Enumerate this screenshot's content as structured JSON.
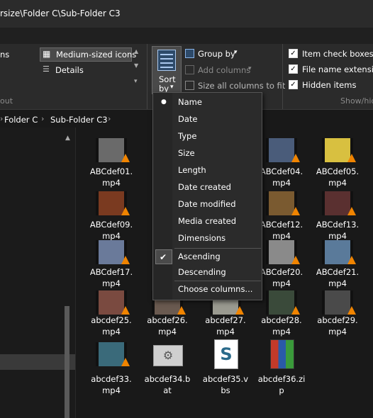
{
  "title": {
    "path": "rsize\\Folder C\\Sub-Folder C3"
  },
  "ribbon": {
    "layout": {
      "partial_left": "ns",
      "medium_icons": "Medium-sized icons",
      "details": "Details",
      "section_label": "out"
    },
    "sort": {
      "label_line1": "Sort",
      "label_line2": "by"
    },
    "group_by": "Group by",
    "add_columns": "Add columns",
    "size_all_columns": "Size all columns to fit",
    "options": {
      "item_check_boxes": "Item check boxes",
      "file_name_extensions": "File name extension",
      "hidden_items": "Hidden items",
      "section_label": "Show/hic"
    }
  },
  "address": {
    "crumbs": [
      "Folder C",
      "Sub-Folder C3"
    ]
  },
  "files": [
    {
      "name": "ABCdef01.mp4",
      "line1": "ABCdef01.",
      "line2": "mp4",
      "type": "video",
      "thumb": "#6a6a6a"
    },
    {
      "name": "ABCdef04.mp4",
      "line1": "ABCdef04.",
      "line2": "mp4",
      "type": "video",
      "thumb": "#4a5c7a"
    },
    {
      "name": "ABCdef05.mp4",
      "line1": "ABCdef05.",
      "line2": "mp4",
      "type": "video",
      "thumb": "#d8c040"
    },
    {
      "name": "ABCdef09.mp4",
      "line1": "ABCdef09.",
      "line2": "mp4",
      "type": "video",
      "thumb": "#7a3a20"
    },
    {
      "name": "ABCdef12.mp4",
      "line1": "ABCdef12.",
      "line2": "mp4",
      "type": "video",
      "thumb": "#7a5a30"
    },
    {
      "name": "ABCdef13.mp4",
      "line1": "ABCdef13.",
      "line2": "mp4",
      "type": "video",
      "thumb": "#5a3030"
    },
    {
      "name": "ABCdef17.mp4",
      "line1": "ABCdef17.",
      "line2": "mp4",
      "type": "video",
      "thumb": "#6a7a9a"
    },
    {
      "name": "ABCdef20.mp4",
      "line1": "ABCdef20.",
      "line2": "mp4",
      "type": "video",
      "thumb": "#8a8a8a"
    },
    {
      "name": "ABCdef21.mp4",
      "line1": "ABCdef21.",
      "line2": "mp4",
      "type": "video",
      "thumb": "#5a7a9a"
    },
    {
      "name": "abcdef25.mp4",
      "line1": "abcdef25.",
      "line2": "mp4",
      "type": "video",
      "thumb": "#7a4a40"
    },
    {
      "name": "abcdef26.mp4",
      "line1": "abcdef26.",
      "line2": "mp4",
      "type": "video",
      "thumb": "#6a5a50"
    },
    {
      "name": "abcdef27.mp4",
      "line1": "abcdef27.",
      "line2": "mp4",
      "type": "video",
      "thumb": "#9a9a90"
    },
    {
      "name": "abcdef28.mp4",
      "line1": "abcdef28.",
      "line2": "mp4",
      "type": "video",
      "thumb": "#3a4a3a"
    },
    {
      "name": "abcdef29.mp4",
      "line1": "abcdef29.",
      "line2": "mp4",
      "type": "video",
      "thumb": "#4a4a4a"
    },
    {
      "name": "abcdef33.mp4",
      "line1": "abcdef33.",
      "line2": "mp4",
      "type": "video",
      "thumb": "#3a6a7a"
    },
    {
      "name": "abcdef34.bat",
      "line1": "abcdef34.b",
      "line2": "at",
      "type": "bat",
      "thumb": "#cfcfcf"
    },
    {
      "name": "abcdef35.vbs",
      "line1": "abcdef35.v",
      "line2": "bs",
      "type": "vbs",
      "thumb": "#ffffff"
    },
    {
      "name": "abcdef36.zip",
      "line1": "abcdef36.zi",
      "line2": "p",
      "type": "zip",
      "thumb": "#c23a2a"
    }
  ],
  "sort_menu": {
    "items": [
      "Name",
      "Date",
      "Type",
      "Size",
      "Length",
      "Date created",
      "Date modified",
      "Media created",
      "Dimensions"
    ],
    "selected": "Name",
    "order": [
      "Ascending",
      "Descending"
    ],
    "order_selected": "Ascending",
    "choose_columns": "Choose columns..."
  },
  "colors": {
    "background": "#191919",
    "ribbon": "#2b2b2b",
    "menu": "#2b2b2b",
    "vlc_orange": "#f08400"
  }
}
